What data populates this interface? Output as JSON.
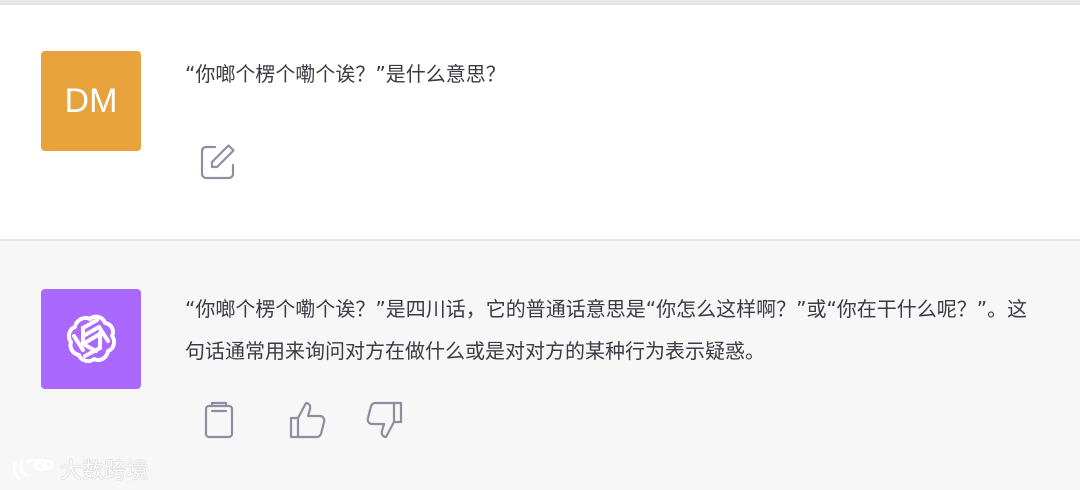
{
  "conversation": {
    "user": {
      "avatar_initials": "DM",
      "message": "“你啷个楞个嘞个诶？”是什么意思？",
      "actions": {
        "edit_icon": "edit-icon"
      }
    },
    "assistant": {
      "avatar_icon": "openai-logo-icon",
      "message": "“你啷个楞个嘞个诶？”是四川话，它的普通话意思是“你怎么这样啊？”或“你在干什么呢？”。这句话通常用来询问对方在做什么或是对对方的某种行为表示疑惑。",
      "actions": {
        "copy_icon": "clipboard-icon",
        "like_icon": "thumbs-up-icon",
        "dislike_icon": "thumbs-down-icon"
      }
    }
  },
  "watermark": {
    "text": "大数跨境"
  },
  "colors": {
    "user_avatar": "#e8a23c",
    "assistant_avatar": "#ab68ff",
    "assistant_background": "#f7f7f8",
    "icon_gray": "#8e8ea0"
  }
}
